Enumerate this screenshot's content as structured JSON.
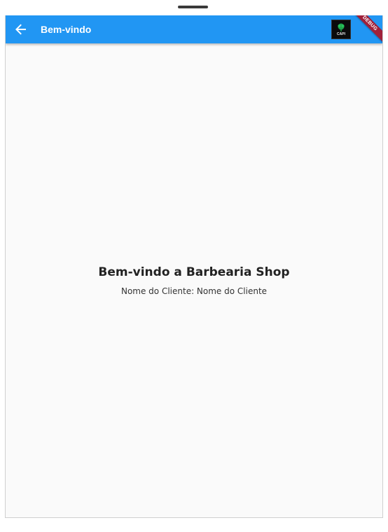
{
  "app_bar": {
    "title": "Bem-vindo",
    "back_icon": "arrow-left-icon",
    "logo_text": "CAPI",
    "background_color": "#2196f3"
  },
  "debug_banner": {
    "label": "DEBUG",
    "color": "#a0203a"
  },
  "main": {
    "heading": "Bem-vindo a Barbearia Shop",
    "client_name_text": "Nome do Cliente: Nome do Cliente"
  }
}
